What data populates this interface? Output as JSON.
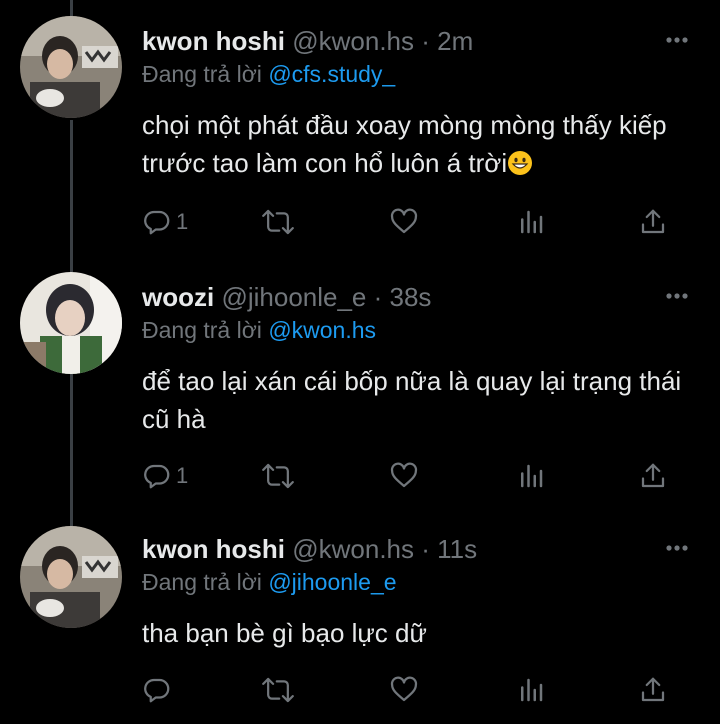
{
  "tweets": [
    {
      "name": "kwon hoshi",
      "handle": "@kwon.hs",
      "time": "2m",
      "reply_label": "Đang trả lời",
      "reply_to": "@cfs.study_",
      "text": "chọi một phát đầu xoay mòng mòng thấy kiếp trước tao làm con hổ luôn á trời",
      "emoji": "grinning-face-emoji",
      "reply_count": "1",
      "retweet_count": "",
      "like_count": ""
    },
    {
      "name": "woozi",
      "handle": "@jihoonle_e",
      "time": "38s",
      "reply_label": "Đang trả lời",
      "reply_to": "@kwon.hs",
      "text": "để tao lại xán cái bốp nữa là quay lại trạng thái cũ hà",
      "reply_count": "1",
      "retweet_count": "",
      "like_count": ""
    },
    {
      "name": "kwon hoshi",
      "handle": "@kwon.hs",
      "time": "11s",
      "reply_label": "Đang trả lời",
      "reply_to": "@jihoonle_e",
      "text": "tha bạn bè gì bạo lực dữ",
      "reply_count": "",
      "retweet_count": "",
      "like_count": ""
    }
  ],
  "separator": " · ",
  "colors": {
    "background": "#000000",
    "text": "#e7e9ea",
    "muted": "#71767b",
    "link": "#1d9bf0",
    "thread_line": "#3a3f44"
  },
  "icons": [
    "more-icon",
    "reply-icon",
    "retweet-icon",
    "like-icon",
    "views-icon",
    "share-icon"
  ]
}
